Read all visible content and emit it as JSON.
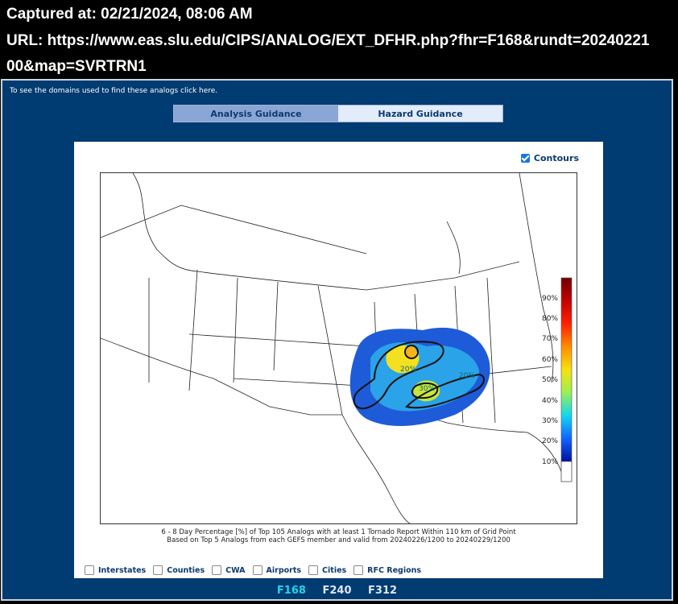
{
  "capture": {
    "captured_at": "Captured at: 02/21/2024, 08:06 AM",
    "url_line1": "URL: https://www.eas.slu.edu/CIPS/ANALOG/EXT_DFHR.php?fhr=F168&rundt=20240221",
    "url_line2": "00&map=SVRTRN1"
  },
  "page": {
    "domains_link": "To see the domains used to find these analogs click here.",
    "tabs": [
      {
        "label": "Analysis Guidance",
        "active": true
      },
      {
        "label": "Hazard Guidance",
        "active": false
      }
    ],
    "contours_label": "Contours",
    "contours_checked": true,
    "caption_line1": "6 - 8 Day Percentage [%] of Top 105 Analogs with at least 1 Tornado Report Within 110 km of Grid Point",
    "caption_line2": "Based on Top 5 Analogs from each GEFS member and valid from 20240226/1200 to 20240229/1200",
    "layers": [
      {
        "label": "Interstates",
        "checked": false
      },
      {
        "label": "Counties",
        "checked": false
      },
      {
        "label": "CWA",
        "checked": false
      },
      {
        "label": "Airports",
        "checked": false
      },
      {
        "label": "Cities",
        "checked": false
      },
      {
        "label": "RFC Regions",
        "checked": false
      }
    ],
    "forecast_hours": [
      {
        "label": "F168",
        "active": true
      },
      {
        "label": "F240",
        "active": false
      },
      {
        "label": "F312",
        "active": false
      }
    ]
  },
  "map": {
    "colorbar_ticks": [
      "10%",
      "20%",
      "30%",
      "40%",
      "50%",
      "60%",
      "70%",
      "80%",
      "90%"
    ],
    "contour_labels": [
      "20%",
      "20%",
      "30%"
    ],
    "colors": {
      "panel": "#003b71",
      "tab_active": "#8aa6d6",
      "tab_inactive": "#e2ecfa",
      "active_hour": "#22d4f0"
    }
  }
}
